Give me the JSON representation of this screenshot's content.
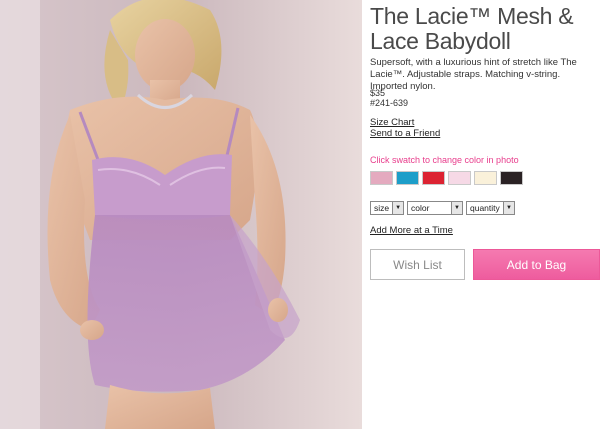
{
  "product": {
    "title": "The Lacie™ Mesh & Lace Babydoll",
    "description": "Supersoft, with a luxurious hint of stretch like The Lacie™. Adjustable straps. Matching v-string. Imported nylon.",
    "price": "$35",
    "sku": "#241-639"
  },
  "links": {
    "size_chart": "Size Chart",
    "send_friend": "Send to a Friend",
    "add_more": "Add More at a Time"
  },
  "swatch_hint": "Click swatch to change color in photo",
  "swatches": [
    {
      "name": "lilac",
      "color": "#e4aabf"
    },
    {
      "name": "aqua",
      "color": "#1d9ec9"
    },
    {
      "name": "red",
      "color": "#dc2332"
    },
    {
      "name": "light-pink",
      "color": "#f6d9e6"
    },
    {
      "name": "cream",
      "color": "#faf1da"
    },
    {
      "name": "black",
      "color": "#2a2224"
    }
  ],
  "selects": {
    "size": "size",
    "color": "color",
    "quantity": "quantity"
  },
  "buttons": {
    "wish_list": "Wish List",
    "add_to_bag": "Add to Bag"
  },
  "colors": {
    "accent_pink": "#ee5c9e",
    "hint_pink": "#e83d8c"
  }
}
